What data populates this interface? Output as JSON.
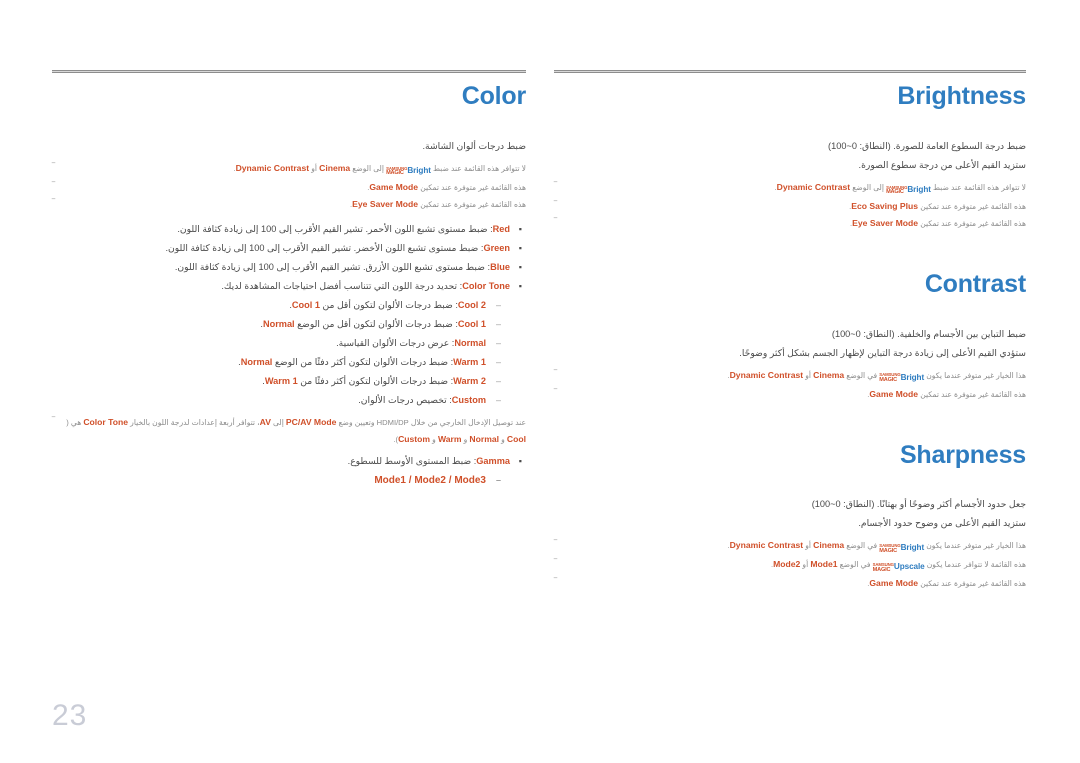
{
  "page": {
    "number": "23",
    "accent_blue": "#2f7dc0",
    "accent_orange": "#d0502a",
    "body_gray": "#4a4a4a",
    "note_gray": "#8a8a8a",
    "rule_gray": "#8d8d8d"
  },
  "magic_logo": {
    "line1": "SAMSUNG",
    "line2": "MAGIC"
  },
  "left_column": {
    "heading": "Color",
    "intro": "ضبط درجات ألوان الشاشة.",
    "notes": [
      {
        "dash": "‾",
        "parts": [
          {
            "t": "text",
            "v": "لا تتوافر هذه القائمة عند ضبط "
          },
          {
            "t": "magic",
            "v": "Bright"
          },
          {
            "t": "text",
            "v": " إلى الوضع "
          },
          {
            "t": "token",
            "v": "Cinema"
          },
          {
            "t": "text",
            "v": " أو "
          },
          {
            "t": "token",
            "v": "Dynamic Contrast"
          },
          {
            "t": "text",
            "v": "."
          }
        ]
      },
      {
        "dash": "‾",
        "parts": [
          {
            "t": "text",
            "v": "هذه القائمة غير متوفرة عند تمكين "
          },
          {
            "t": "token",
            "v": "Game Mode"
          },
          {
            "t": "text",
            "v": "."
          }
        ]
      },
      {
        "dash": "‾",
        "parts": [
          {
            "t": "text",
            "v": "هذه القائمة غير متوفرة عند تمكين "
          },
          {
            "t": "token",
            "v": "Eye Saver Mode"
          },
          {
            "t": "text",
            "v": "."
          }
        ]
      }
    ],
    "bullets": [
      {
        "mark": "▪",
        "parts": [
          {
            "t": "token",
            "v": "Red"
          },
          {
            "t": "text",
            "v": ": ضبط مستوى تشبع اللون الأحمر. تشير القيم الأقرب إلى 100 إلى زيادة كثافة اللون."
          }
        ]
      },
      {
        "mark": "▪",
        "parts": [
          {
            "t": "token",
            "v": "Green"
          },
          {
            "t": "text",
            "v": ": ضبط مستوى تشبع اللون الأخضر. تشير القيم الأقرب إلى 100 إلى زيادة كثافة اللون."
          }
        ]
      },
      {
        "mark": "▪",
        "parts": [
          {
            "t": "token",
            "v": "Blue"
          },
          {
            "t": "text",
            "v": ": ضبط مستوى تشبع اللون الأزرق. تشير القيم الأقرب إلى 100 إلى زيادة كثافة اللون."
          }
        ]
      },
      {
        "mark": "▪",
        "parts": [
          {
            "t": "token",
            "v": "Color Tone"
          },
          {
            "t": "text",
            "v": ": تحديد درجة اللون التي تتناسب أفضل احتياجات المشاهدة لديك."
          }
        ]
      }
    ],
    "subbullets": [
      {
        "mark": "–",
        "parts": [
          {
            "t": "token",
            "v": "Cool 2"
          },
          {
            "t": "text",
            "v": ": ضبط درجات الألوان لتكون أقل من "
          },
          {
            "t": "token",
            "v": "Cool 1"
          },
          {
            "t": "text",
            "v": "."
          }
        ]
      },
      {
        "mark": "–",
        "parts": [
          {
            "t": "token",
            "v": "Cool 1"
          },
          {
            "t": "text",
            "v": ": ضبط درجات الألوان لتكون أقل من الوضع "
          },
          {
            "t": "token",
            "v": "Normal"
          },
          {
            "t": "text",
            "v": "."
          }
        ]
      },
      {
        "mark": "–",
        "parts": [
          {
            "t": "token",
            "v": "Normal"
          },
          {
            "t": "text",
            "v": ": عرض درجات الألوان القياسية."
          }
        ]
      },
      {
        "mark": "–",
        "parts": [
          {
            "t": "token",
            "v": "Warm 1"
          },
          {
            "t": "text",
            "v": ": ضبط درجات الألوان لتكون أكثر دفئًا من الوضع "
          },
          {
            "t": "token",
            "v": "Normal"
          },
          {
            "t": "text",
            "v": "."
          }
        ]
      },
      {
        "mark": "–",
        "parts": [
          {
            "t": "token",
            "v": "Warm 2"
          },
          {
            "t": "text",
            "v": ": ضبط درجات الألوان لتكون أكثر دفئًا من "
          },
          {
            "t": "token",
            "v": "Warm 1"
          },
          {
            "t": "text",
            "v": "."
          }
        ]
      },
      {
        "mark": "–",
        "parts": [
          {
            "t": "token",
            "v": "Custom"
          },
          {
            "t": "text",
            "v": ": تخصيص درجات الألوان."
          }
        ]
      }
    ],
    "note_hdmi": {
      "dash": "‾",
      "parts": [
        {
          "t": "text",
          "v": "عند توصيل الإدخال الخارجي من خلال HDMI/DP وتعيين وضع "
        },
        {
          "t": "token",
          "v": "PC/AV Mode"
        },
        {
          "t": "text",
          "v": " إلى "
        },
        {
          "t": "token",
          "v": "AV"
        },
        {
          "t": "text",
          "v": "، تتوافر أربعة إعدادات لدرجة اللون بالخيار "
        },
        {
          "t": "token",
          "v": "Color Tone"
        },
        {
          "t": "text",
          "v": " هي ("
        },
        {
          "t": "token",
          "v": "Cool"
        },
        {
          "t": "text",
          "v": " و "
        },
        {
          "t": "token",
          "v": "Normal"
        },
        {
          "t": "text",
          "v": " و "
        },
        {
          "t": "token",
          "v": "Warm"
        },
        {
          "t": "text",
          "v": " و "
        },
        {
          "t": "token",
          "v": "Custom"
        },
        {
          "t": "text",
          "v": ")."
        }
      ]
    },
    "gamma_bullet": {
      "mark": "▪",
      "parts": [
        {
          "t": "token",
          "v": "Gamma"
        },
        {
          "t": "text",
          "v": ": ضبط المستوى الأوسط للسطوع."
        }
      ]
    },
    "gamma_modes": {
      "mark": "–",
      "label": "Mode1 / Mode2 / Mode3"
    }
  },
  "right_column": {
    "sections": [
      {
        "heading": "Brightness",
        "paragraphs": [
          "ضبط درجة السطوع العامة للصورة. (النطاق: 0~100)",
          "ستزيد القيم الأعلى من درجة سطوع الصورة."
        ],
        "notes": [
          {
            "dash": "‾",
            "parts": [
              {
                "t": "text",
                "v": "لا تتوافر هذه القائمة عند ضبط "
              },
              {
                "t": "magic",
                "v": "Bright"
              },
              {
                "t": "text",
                "v": " إلى الوضع "
              },
              {
                "t": "token",
                "v": "Dynamic Contrast"
              },
              {
                "t": "text",
                "v": "."
              }
            ]
          },
          {
            "dash": "‾",
            "parts": [
              {
                "t": "text",
                "v": "هذه القائمة غير متوفرة عند تمكين "
              },
              {
                "t": "token",
                "v": "Eco Saving Plus"
              },
              {
                "t": "text",
                "v": "."
              }
            ]
          },
          {
            "dash": "‾",
            "parts": [
              {
                "t": "text",
                "v": "هذه القائمة غير متوفرة عند تمكين "
              },
              {
                "t": "token",
                "v": "Eye Saver Mode"
              },
              {
                "t": "text",
                "v": "."
              }
            ]
          }
        ]
      },
      {
        "heading": "Contrast",
        "paragraphs": [
          "ضبط التباين بين الأجسام والخلفية. (النطاق: 0~100)",
          "ستؤدي القيم الأعلى إلى زيادة درجة التباين لإظهار الجسم بشكل أكثر وضوحًا."
        ],
        "notes": [
          {
            "dash": "‾",
            "parts": [
              {
                "t": "text",
                "v": "هذا الخيار غير متوفر عندما يكون "
              },
              {
                "t": "magic",
                "v": "Bright"
              },
              {
                "t": "text",
                "v": " في الوضع "
              },
              {
                "t": "token",
                "v": "Cinema"
              },
              {
                "t": "text",
                "v": " أو "
              },
              {
                "t": "token",
                "v": "Dynamic Contrast"
              },
              {
                "t": "text",
                "v": "."
              }
            ]
          },
          {
            "dash": "‾",
            "parts": [
              {
                "t": "text",
                "v": "هذه القائمة غير متوفرة عند تمكين "
              },
              {
                "t": "token",
                "v": "Game Mode"
              },
              {
                "t": "text",
                "v": "."
              }
            ]
          }
        ]
      },
      {
        "heading": "Sharpness",
        "paragraphs": [
          "جعل حدود الأجسام أكثر وضوحًا أو بهتانًا. (النطاق: 0~100)",
          "ستزيد القيم الأعلى من وضوح حدود الأجسام."
        ],
        "notes": [
          {
            "dash": "‾",
            "parts": [
              {
                "t": "text",
                "v": "هذا الخيار غير متوفر عندما يكون "
              },
              {
                "t": "magic",
                "v": "Bright"
              },
              {
                "t": "text",
                "v": " في الوضع "
              },
              {
                "t": "token",
                "v": "Cinema"
              },
              {
                "t": "text",
                "v": " أو "
              },
              {
                "t": "token",
                "v": "Dynamic Contrast"
              },
              {
                "t": "text",
                "v": "."
              }
            ]
          },
          {
            "dash": "‾",
            "parts": [
              {
                "t": "text",
                "v": "هذه القائمة لا تتوافر عندما يكون "
              },
              {
                "t": "magic",
                "v": "Upscale"
              },
              {
                "t": "text",
                "v": " في الوضع "
              },
              {
                "t": "token",
                "v": "Mode1"
              },
              {
                "t": "text",
                "v": " أو "
              },
              {
                "t": "token",
                "v": "Mode2"
              },
              {
                "t": "text",
                "v": "."
              }
            ]
          },
          {
            "dash": "‾",
            "parts": [
              {
                "t": "text",
                "v": "هذه القائمة غير متوفرة عند تمكين "
              },
              {
                "t": "token",
                "v": "Game Mode"
              },
              {
                "t": "text",
                "v": "."
              }
            ]
          }
        ]
      }
    ]
  }
}
